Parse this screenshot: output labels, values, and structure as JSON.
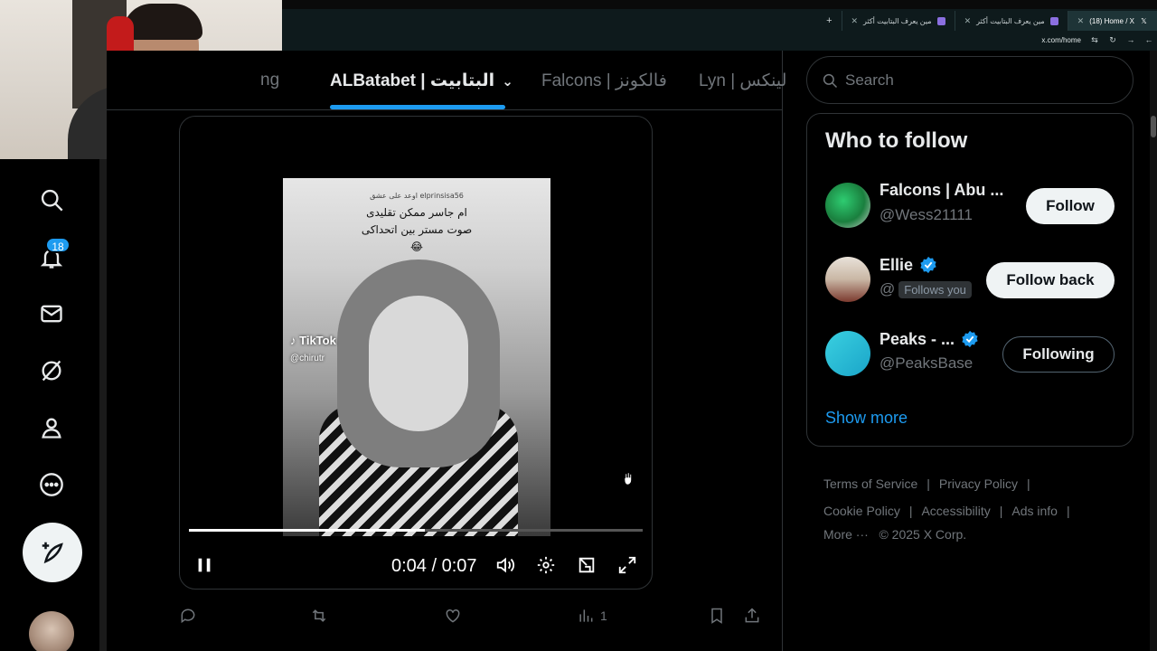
{
  "browser": {
    "tabs": [
      {
        "label": "مين يعرف البتابيت أكثر",
        "favicon": "purple-square-icon"
      },
      {
        "label": "مين يعرف البتابيت أكثر",
        "favicon": "purple-square-icon"
      },
      {
        "label": "(18) Home / X",
        "favicon": "x-logo-icon",
        "active": true
      }
    ],
    "url": "x.com/home"
  },
  "nav": {
    "items": [
      "search-icon",
      "notifications-icon",
      "messages-icon",
      "grok-icon",
      "profile-icon",
      "more-icon"
    ],
    "notification_count": "18",
    "post_icon": "compose-post-icon"
  },
  "feed": {
    "tabs": {
      "partial_left": "ng",
      "active": "ALBatabet | البتابيت",
      "second": "Falcons | فالكونز",
      "third": "Lyn | لينكس"
    },
    "accent": "#1d9bf0",
    "video": {
      "caption_user": "elprinsisa56 اوعد على عشق",
      "caption_line1": "ام جاسر ممكن تقليدى",
      "caption_line2": "صوت مستر بين اتحداكى",
      "caption_emoji": "😂",
      "watermark": "TikTok",
      "watermark_user": "@chirutr",
      "time": "0:04 / 0:07",
      "progress": 0.52
    },
    "actions": {
      "views": "1"
    }
  },
  "sidebar": {
    "search_placeholder": "Search",
    "who_to_follow": {
      "title": "Who to follow",
      "users": [
        {
          "name": "Falcons | Abu ...",
          "handle": "@Wess21111",
          "button": "Follow",
          "verified": false,
          "follows_you": false
        },
        {
          "name": "Ellie",
          "handle": "@",
          "button": "Follow back",
          "verified": true,
          "follows_you": true,
          "follows_you_label": "Follows you"
        },
        {
          "name": "Peaks - ...",
          "handle": "@PeaksBase",
          "button": "Following",
          "verified": true,
          "follows_you": false
        }
      ],
      "show_more": "Show more"
    },
    "footer": {
      "terms": "Terms of Service",
      "privacy": "Privacy Policy",
      "cookie": "Cookie Policy",
      "accessibility": "Accessibility",
      "ads": "Ads info",
      "more": "More ···",
      "copyright": "© 2025 X Corp."
    }
  }
}
